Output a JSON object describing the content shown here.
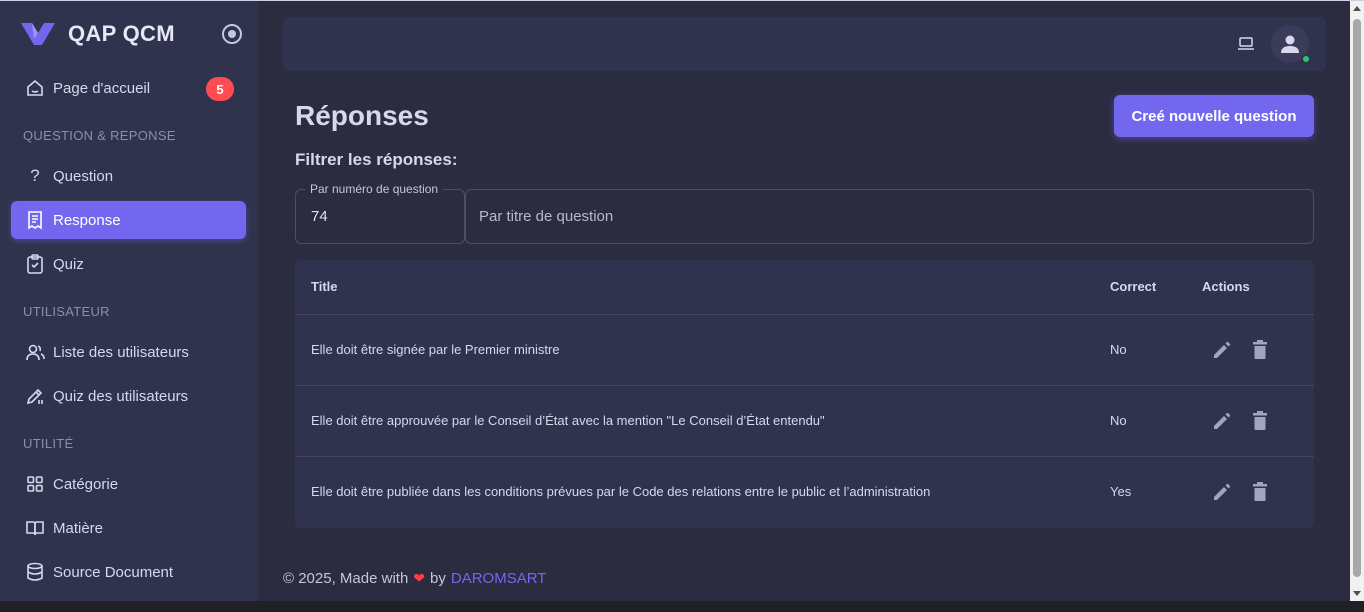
{
  "app": {
    "title": "QAP QCM"
  },
  "sidebar": {
    "home": {
      "label": "Page d'accueil",
      "badge": "5"
    },
    "sections": {
      "qa": "QUESTION & REPONSE",
      "user": "UTILISATEUR",
      "util": "UTILITÉ"
    },
    "items": {
      "question": "Question",
      "response": "Response",
      "quiz": "Quiz",
      "users_list": "Liste des utilisateurs",
      "users_quiz": "Quiz des utilisateurs",
      "category": "Catégorie",
      "subject": "Matière",
      "source": "Source Document"
    }
  },
  "page": {
    "title": "Réponses",
    "create_button": "Creé nouvelle question",
    "filter_label": "Filtrer les réponses:",
    "filter_number": {
      "label": "Par numéro de question",
      "value": "74"
    },
    "filter_title": {
      "placeholder": "Par titre de question"
    }
  },
  "table": {
    "headers": {
      "title": "Title",
      "correct": "Correct",
      "actions": "Actions"
    },
    "rows": [
      {
        "title": "Elle doit être signée par le Premier ministre",
        "correct": "No"
      },
      {
        "title": "Elle doit être approuvée par le Conseil d’État avec la mention \"Le Conseil d’État entendu\"",
        "correct": "No"
      },
      {
        "title": "Elle doit être publiée dans les conditions prévues par le Code des relations entre le public et l’administration",
        "correct": "Yes"
      }
    ]
  },
  "footer": {
    "prefix": "© 2025, Made with",
    "by": "by",
    "author": "DAROMSART"
  },
  "colors": {
    "accent": "#7367f0",
    "badge": "#ff4c51",
    "sidebar": "#30334e",
    "background": "#2b2c40",
    "online": "#28c76f"
  }
}
